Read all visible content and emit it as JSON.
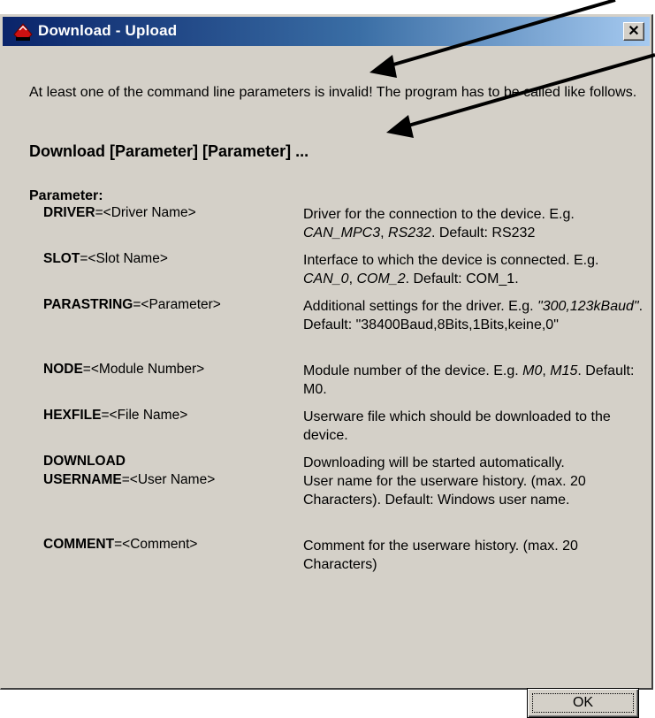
{
  "window": {
    "title": "Download - Upload",
    "close_glyph": "✕"
  },
  "message": {
    "intro": "At least one of the command line parameters is invalid! The program has to be called like follows.",
    "usage": "Download [Parameter] [Parameter] ...",
    "parameter_header": "Parameter:"
  },
  "parameters": [
    {
      "key": "DRIVER",
      "eq": "=",
      "arg": "<Driver Name>",
      "desc": [
        [
          "Driver for the connection to the device. E.g. ",
          ""
        ],
        [
          "CAN_MPC3",
          "i"
        ],
        [
          ", ",
          ""
        ],
        [
          "RS232",
          "i"
        ],
        [
          ". Default: RS232",
          ""
        ]
      ]
    },
    {
      "key": "SLOT",
      "eq": "=",
      "arg": "<Slot Name>",
      "desc": [
        [
          "Interface to which the device is connected. E.g. ",
          ""
        ],
        [
          "CAN_0",
          "i"
        ],
        [
          ", ",
          ""
        ],
        [
          "COM_2",
          "i"
        ],
        [
          ". Default: COM_1.",
          ""
        ]
      ]
    },
    {
      "key": "PARASTRING",
      "eq": "=",
      "arg": "<Parameter>",
      "desc": [
        [
          "Additional settings for the driver. E.g. ",
          ""
        ],
        [
          "\"300,123kBaud\"",
          "i"
        ],
        [
          ". Default: \"38400Baud,8Bits,1Bits,keine,0\"",
          ""
        ]
      ]
    },
    {
      "key": "NODE",
      "eq": "=",
      "arg": "<Module Number>",
      "desc": [
        [
          "Module number of the device. E.g. ",
          ""
        ],
        [
          "M0",
          "i"
        ],
        [
          ", ",
          ""
        ],
        [
          "M15",
          "i"
        ],
        [
          ". Default: M0.",
          ""
        ]
      ]
    },
    {
      "key": "HEXFILE",
      "eq": "=",
      "arg": "<File Name>",
      "desc": [
        [
          "Userware file which should be downloaded to the device.",
          ""
        ]
      ]
    },
    {
      "key": "DOWNLOAD",
      "eq": "",
      "arg": "",
      "desc": [
        [
          "Downloading will be started automatically.",
          ""
        ]
      ]
    },
    {
      "key": "USERNAME",
      "eq": "=",
      "arg": "<User Name>",
      "desc": [
        [
          "User name for the userware history. (max. 20 Characters). Default: Windows user name.",
          ""
        ]
      ]
    },
    {
      "key": "COMMENT",
      "eq": "=",
      "arg": "<Comment>",
      "desc": [
        [
          "Comment for the userware history. (max. 20 Characters)",
          ""
        ]
      ]
    }
  ],
  "buttons": {
    "ok_label": "OK"
  },
  "colors": {
    "title_start": "#0a246a",
    "title_end": "#a6caf0",
    "face": "#d4d0c8"
  },
  "icons": {
    "app": "red-hat-app-icon",
    "close": "close-icon"
  }
}
